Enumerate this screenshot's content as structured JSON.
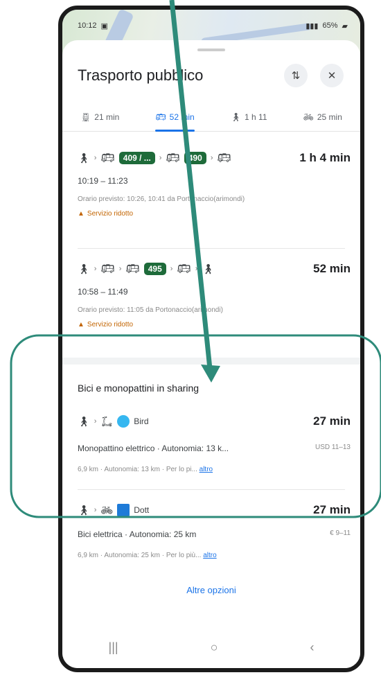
{
  "status_bar": {
    "time": "10:12",
    "battery": "65%"
  },
  "header": {
    "title": "Trasporto pubblico",
    "filter_icon": "tune-icon",
    "close_icon": "close-icon"
  },
  "tabs": [
    {
      "icon": "train-icon",
      "label": "21 min"
    },
    {
      "icon": "bus-icon",
      "label": "52 min"
    },
    {
      "icon": "walk-icon",
      "label": "1 h 11"
    },
    {
      "icon": "bike-icon",
      "label": "25 min"
    }
  ],
  "routes": [
    {
      "badges": [
        "409 / ...",
        "490"
      ],
      "duration": "1 h 4 min",
      "times": "10:19 – 11:23",
      "schedule": "Orario previsto: 10:26, 10:41 da Portonaccio(arimondi)",
      "warning": "Servizio ridotto"
    },
    {
      "badges": [
        "495"
      ],
      "duration": "52 min",
      "times": "10:58 – 11:49",
      "schedule": "Orario previsto: 11:05 da Portonaccio(arimondi)",
      "warning": "Servizio ridotto"
    }
  ],
  "sharing": {
    "title": "Bici e monopattini in sharing",
    "items": [
      {
        "provider": "Bird",
        "duration": "27 min",
        "desc": "Monopattino elettrico · Autonomia: 13 k...",
        "price": "USD 11–13",
        "sub": "6,9 km · Autonomia: 13 km · Per lo pi...",
        "more": "altro"
      },
      {
        "provider": "Dott",
        "duration": "27 min",
        "desc": "Bici elettrica · Autonomia: 25 km",
        "price": "€ 9–11",
        "sub": "6,9 km · Autonomia: 25 km · Per lo più...",
        "more": "altro"
      }
    ],
    "more_options": "Altre opzioni"
  },
  "annotation_color": "#2e8b7a"
}
